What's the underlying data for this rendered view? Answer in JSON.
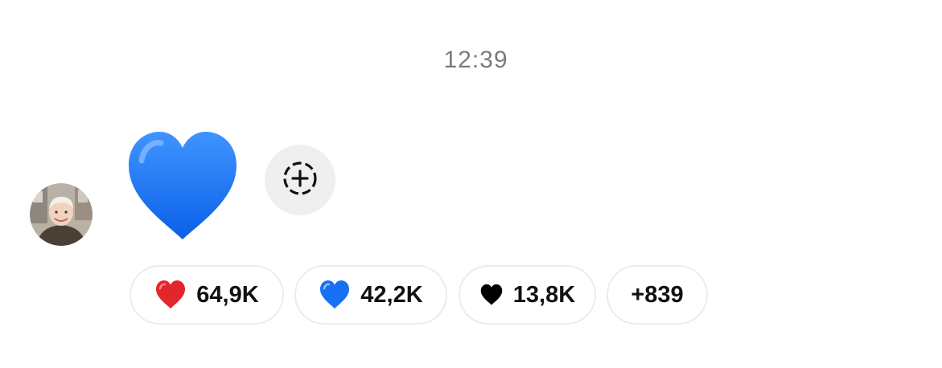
{
  "message": {
    "timestamp": "12:39",
    "content_emoji": "blue-heart",
    "sender_avatar": "child-portrait-avatar"
  },
  "add_reaction": {
    "icon": "dashed-circle-plus-icon"
  },
  "reactions": [
    {
      "emoji": "red-heart",
      "count": "64,9K",
      "color": "#e3262b"
    },
    {
      "emoji": "blue-heart",
      "count": "42,2K",
      "color": "#1670f2"
    },
    {
      "emoji": "black-heart",
      "count": "13,8K",
      "color": "#000000"
    },
    {
      "count": "+839"
    }
  ],
  "colors": {
    "timestamp": "#7b7b7b",
    "add_button_bg": "#efefef",
    "pill_border": "#ececec"
  }
}
